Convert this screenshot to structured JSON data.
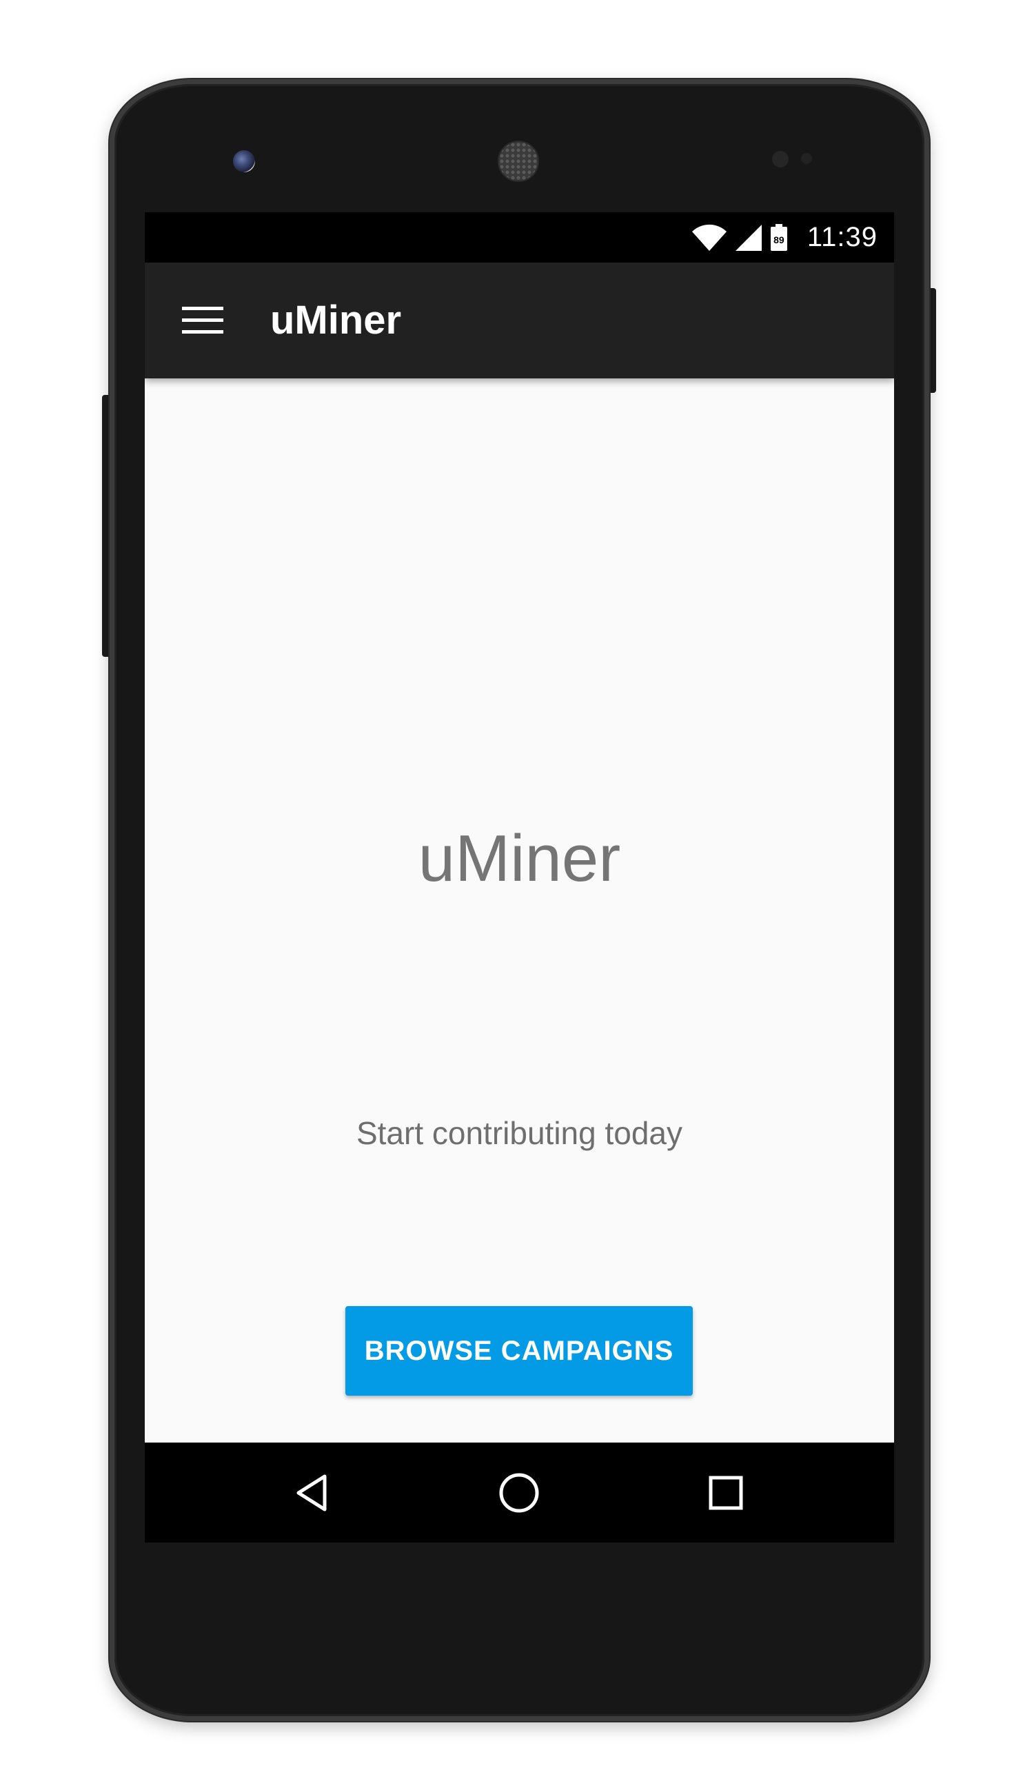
{
  "status_bar": {
    "time": "11:39",
    "battery_level": "89",
    "icons": [
      "wifi-icon",
      "cell-signal-icon",
      "battery-icon"
    ]
  },
  "app_bar": {
    "title": "uMiner",
    "menu_icon": "menu-icon"
  },
  "main": {
    "title": "uMiner",
    "subtitle": "Start contributing today",
    "button_label": "BROWSE CAMPAIGNS"
  },
  "nav_bar": {
    "buttons": [
      "back-icon",
      "home-icon",
      "recents-icon"
    ]
  },
  "colors": {
    "app_bar": "#212121",
    "accent": "#039be5",
    "background": "#fafafa",
    "status_bar": "#000000",
    "text_secondary": "#757575"
  }
}
